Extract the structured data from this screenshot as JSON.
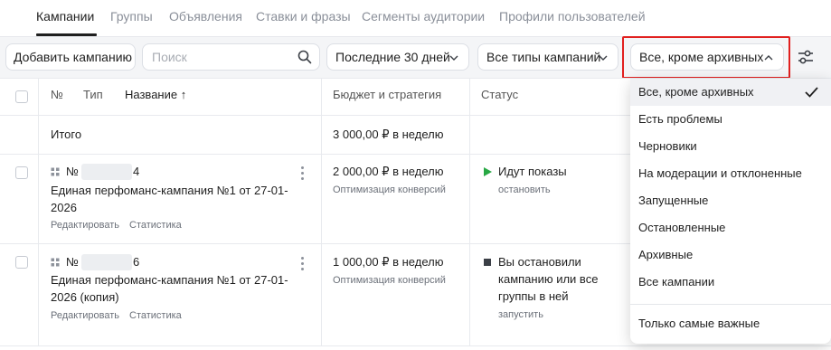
{
  "tabs": [
    "Кампании",
    "Группы",
    "Объявления",
    "Ставки и фразы",
    "Сегменты аудитории",
    "Профили пользователей"
  ],
  "toolbar": {
    "add_campaign": "Добавить кампанию",
    "search_placeholder": "Поиск",
    "period": "Последние 30 дней",
    "campaign_types": "Все типы кампаний",
    "status_filter": "Все, кроме архивных"
  },
  "table": {
    "headers": {
      "number": "№",
      "type": "Тип",
      "name": "Название ↑",
      "budget": "Бюджет и стратегия",
      "status": "Статус"
    },
    "total": {
      "label": "Итого",
      "budget": "3 000,00 ₽ в неделю"
    },
    "rows": [
      {
        "number_prefix": "№",
        "number_suffix": "4",
        "name_line1": "Единая перфоманс-кампания №1 от 27-01-",
        "name_line2": "2026",
        "edit": "Редактировать",
        "stats": "Статистика",
        "budget": "2 000,00 ₽ в неделю",
        "strategy": "Оптимизация конверсий",
        "status": "Идут показы",
        "status_action": "остановить"
      },
      {
        "number_prefix": "№",
        "number_suffix": "6",
        "name_line1": "Единая перфоманс-кампания №1 от 27-01-",
        "name_line2": "2026 (копия)",
        "edit": "Редактировать",
        "stats": "Статистика",
        "budget": "1 000,00 ₽ в неделю",
        "strategy": "Оптимизация конверсий",
        "status_line1": "Вы остановили",
        "status_line2": "кампанию или все",
        "status_line3": "группы в ней",
        "status_action": "запустить"
      }
    ]
  },
  "dropdown": {
    "options": [
      "Все, кроме архивных",
      "Есть проблемы",
      "Черновики",
      "На модерации и отклоненные",
      "Запущенные",
      "Остановленные",
      "Архивные",
      "Все кампании"
    ],
    "extra": "Только самые важные",
    "selected": "Все, кроме архивных"
  },
  "colors": {
    "status_running": "#27a844",
    "status_stopped": "#3b3f46",
    "highlight": "#e1201f"
  }
}
